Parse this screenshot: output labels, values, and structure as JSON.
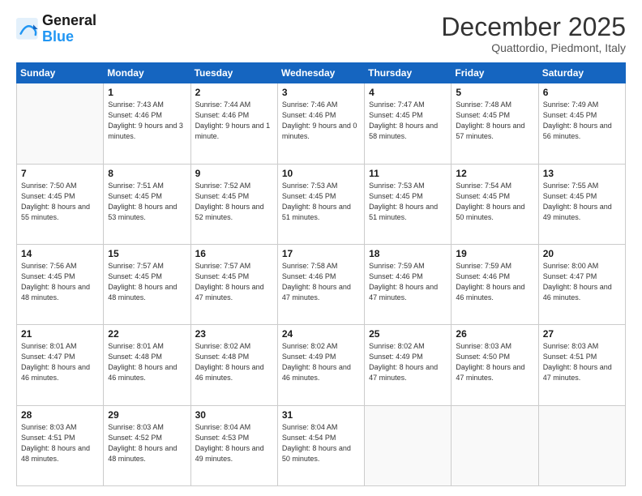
{
  "header": {
    "logo_line1": "General",
    "logo_line2": "Blue",
    "month_title": "December 2025",
    "location": "Quattordio, Piedmont, Italy"
  },
  "days_of_week": [
    "Sunday",
    "Monday",
    "Tuesday",
    "Wednesday",
    "Thursday",
    "Friday",
    "Saturday"
  ],
  "weeks": [
    [
      {
        "day": "",
        "sunrise": "",
        "sunset": "",
        "daylight": ""
      },
      {
        "day": "1",
        "sunrise": "Sunrise: 7:43 AM",
        "sunset": "Sunset: 4:46 PM",
        "daylight": "Daylight: 9 hours and 3 minutes."
      },
      {
        "day": "2",
        "sunrise": "Sunrise: 7:44 AM",
        "sunset": "Sunset: 4:46 PM",
        "daylight": "Daylight: 9 hours and 1 minute."
      },
      {
        "day": "3",
        "sunrise": "Sunrise: 7:46 AM",
        "sunset": "Sunset: 4:46 PM",
        "daylight": "Daylight: 9 hours and 0 minutes."
      },
      {
        "day": "4",
        "sunrise": "Sunrise: 7:47 AM",
        "sunset": "Sunset: 4:45 PM",
        "daylight": "Daylight: 8 hours and 58 minutes."
      },
      {
        "day": "5",
        "sunrise": "Sunrise: 7:48 AM",
        "sunset": "Sunset: 4:45 PM",
        "daylight": "Daylight: 8 hours and 57 minutes."
      },
      {
        "day": "6",
        "sunrise": "Sunrise: 7:49 AM",
        "sunset": "Sunset: 4:45 PM",
        "daylight": "Daylight: 8 hours and 56 minutes."
      }
    ],
    [
      {
        "day": "7",
        "sunrise": "Sunrise: 7:50 AM",
        "sunset": "Sunset: 4:45 PM",
        "daylight": "Daylight: 8 hours and 55 minutes."
      },
      {
        "day": "8",
        "sunrise": "Sunrise: 7:51 AM",
        "sunset": "Sunset: 4:45 PM",
        "daylight": "Daylight: 8 hours and 53 minutes."
      },
      {
        "day": "9",
        "sunrise": "Sunrise: 7:52 AM",
        "sunset": "Sunset: 4:45 PM",
        "daylight": "Daylight: 8 hours and 52 minutes."
      },
      {
        "day": "10",
        "sunrise": "Sunrise: 7:53 AM",
        "sunset": "Sunset: 4:45 PM",
        "daylight": "Daylight: 8 hours and 51 minutes."
      },
      {
        "day": "11",
        "sunrise": "Sunrise: 7:53 AM",
        "sunset": "Sunset: 4:45 PM",
        "daylight": "Daylight: 8 hours and 51 minutes."
      },
      {
        "day": "12",
        "sunrise": "Sunrise: 7:54 AM",
        "sunset": "Sunset: 4:45 PM",
        "daylight": "Daylight: 8 hours and 50 minutes."
      },
      {
        "day": "13",
        "sunrise": "Sunrise: 7:55 AM",
        "sunset": "Sunset: 4:45 PM",
        "daylight": "Daylight: 8 hours and 49 minutes."
      }
    ],
    [
      {
        "day": "14",
        "sunrise": "Sunrise: 7:56 AM",
        "sunset": "Sunset: 4:45 PM",
        "daylight": "Daylight: 8 hours and 48 minutes."
      },
      {
        "day": "15",
        "sunrise": "Sunrise: 7:57 AM",
        "sunset": "Sunset: 4:45 PM",
        "daylight": "Daylight: 8 hours and 48 minutes."
      },
      {
        "day": "16",
        "sunrise": "Sunrise: 7:57 AM",
        "sunset": "Sunset: 4:45 PM",
        "daylight": "Daylight: 8 hours and 47 minutes."
      },
      {
        "day": "17",
        "sunrise": "Sunrise: 7:58 AM",
        "sunset": "Sunset: 4:46 PM",
        "daylight": "Daylight: 8 hours and 47 minutes."
      },
      {
        "day": "18",
        "sunrise": "Sunrise: 7:59 AM",
        "sunset": "Sunset: 4:46 PM",
        "daylight": "Daylight: 8 hours and 47 minutes."
      },
      {
        "day": "19",
        "sunrise": "Sunrise: 7:59 AM",
        "sunset": "Sunset: 4:46 PM",
        "daylight": "Daylight: 8 hours and 46 minutes."
      },
      {
        "day": "20",
        "sunrise": "Sunrise: 8:00 AM",
        "sunset": "Sunset: 4:47 PM",
        "daylight": "Daylight: 8 hours and 46 minutes."
      }
    ],
    [
      {
        "day": "21",
        "sunrise": "Sunrise: 8:01 AM",
        "sunset": "Sunset: 4:47 PM",
        "daylight": "Daylight: 8 hours and 46 minutes."
      },
      {
        "day": "22",
        "sunrise": "Sunrise: 8:01 AM",
        "sunset": "Sunset: 4:48 PM",
        "daylight": "Daylight: 8 hours and 46 minutes."
      },
      {
        "day": "23",
        "sunrise": "Sunrise: 8:02 AM",
        "sunset": "Sunset: 4:48 PM",
        "daylight": "Daylight: 8 hours and 46 minutes."
      },
      {
        "day": "24",
        "sunrise": "Sunrise: 8:02 AM",
        "sunset": "Sunset: 4:49 PM",
        "daylight": "Daylight: 8 hours and 46 minutes."
      },
      {
        "day": "25",
        "sunrise": "Sunrise: 8:02 AM",
        "sunset": "Sunset: 4:49 PM",
        "daylight": "Daylight: 8 hours and 47 minutes."
      },
      {
        "day": "26",
        "sunrise": "Sunrise: 8:03 AM",
        "sunset": "Sunset: 4:50 PM",
        "daylight": "Daylight: 8 hours and 47 minutes."
      },
      {
        "day": "27",
        "sunrise": "Sunrise: 8:03 AM",
        "sunset": "Sunset: 4:51 PM",
        "daylight": "Daylight: 8 hours and 47 minutes."
      }
    ],
    [
      {
        "day": "28",
        "sunrise": "Sunrise: 8:03 AM",
        "sunset": "Sunset: 4:51 PM",
        "daylight": "Daylight: 8 hours and 48 minutes."
      },
      {
        "day": "29",
        "sunrise": "Sunrise: 8:03 AM",
        "sunset": "Sunset: 4:52 PM",
        "daylight": "Daylight: 8 hours and 48 minutes."
      },
      {
        "day": "30",
        "sunrise": "Sunrise: 8:04 AM",
        "sunset": "Sunset: 4:53 PM",
        "daylight": "Daylight: 8 hours and 49 minutes."
      },
      {
        "day": "31",
        "sunrise": "Sunrise: 8:04 AM",
        "sunset": "Sunset: 4:54 PM",
        "daylight": "Daylight: 8 hours and 50 minutes."
      },
      {
        "day": "",
        "sunrise": "",
        "sunset": "",
        "daylight": ""
      },
      {
        "day": "",
        "sunrise": "",
        "sunset": "",
        "daylight": ""
      },
      {
        "day": "",
        "sunrise": "",
        "sunset": "",
        "daylight": ""
      }
    ]
  ]
}
